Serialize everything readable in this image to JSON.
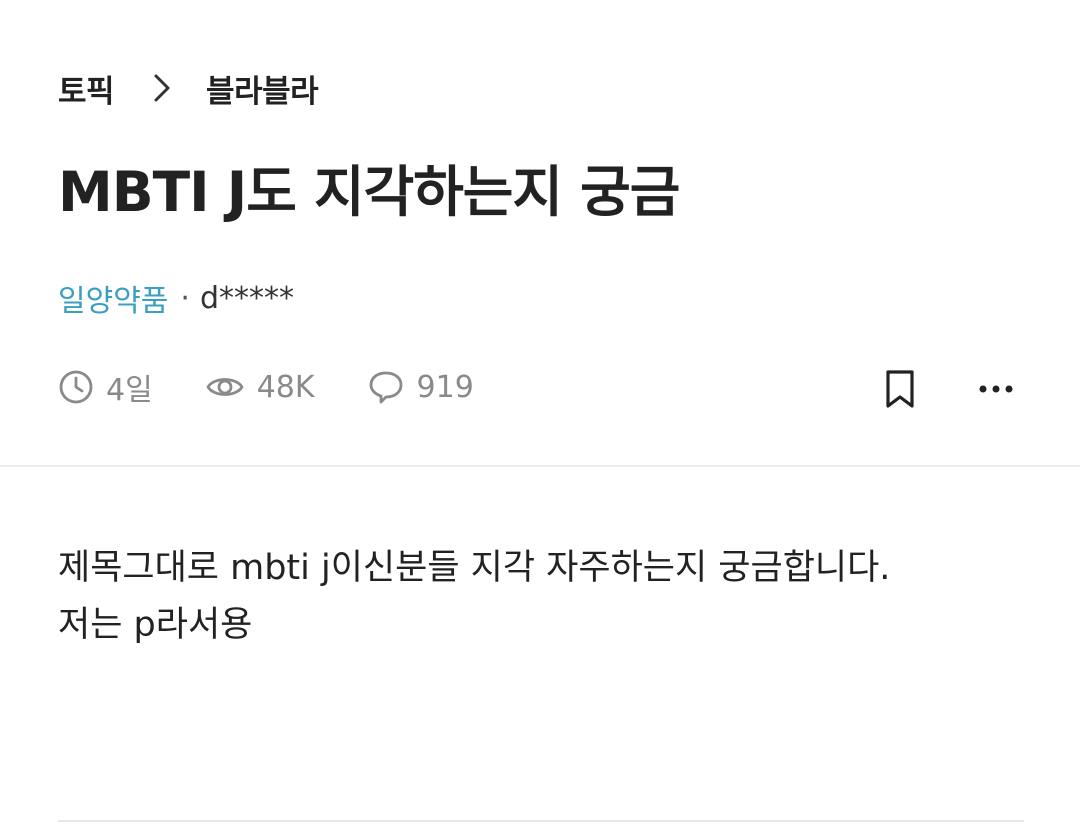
{
  "breadcrumb": {
    "topic": "토픽",
    "board": "블라블라"
  },
  "post": {
    "title": "MBTI J도 지각하는지 궁금",
    "company": "일양약품",
    "separator": "·",
    "author": "d*****",
    "body": "제목그대로 mbti j이신분들 지각 자주하는지 궁금합니다.\n저는 p라서용"
  },
  "stats": {
    "time": "4일",
    "views": "48K",
    "comments": "919"
  },
  "colors": {
    "company": "#3a9fc0",
    "stat": "#8a8a8a",
    "text": "#222222"
  },
  "icons": {
    "chevron": "chevron-right-icon",
    "clock": "clock-icon",
    "views": "eye-icon",
    "comments": "comment-icon",
    "bookmark": "bookmark-icon",
    "more": "more-horizontal-icon"
  }
}
